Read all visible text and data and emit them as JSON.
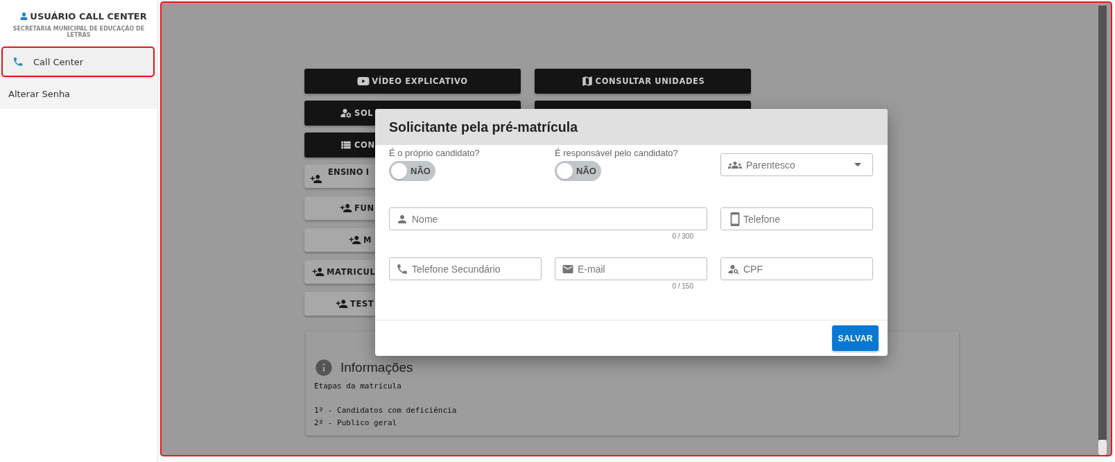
{
  "sidebar": {
    "user_title": "USUÁRIO CALL CENTER",
    "organization": "SECRETARIA MUNICIPAL DE EDUCAÇÃO DE LETRAS",
    "items": [
      {
        "label": "Call Center",
        "selected": true
      },
      {
        "label": "Alterar Senha",
        "selected": false
      }
    ]
  },
  "main": {
    "left_buttons": [
      {
        "label": "VÍDEO EXPLICATIVO",
        "kind": "dark"
      },
      {
        "label": "SOL",
        "kind": "dark"
      },
      {
        "label": "CON",
        "kind": "dark"
      },
      {
        "label": "ENSINO I",
        "kind": "light"
      },
      {
        "label": "FUN",
        "kind": "light"
      },
      {
        "label": "M",
        "kind": "light"
      },
      {
        "label": "MATRICUL",
        "kind": "light"
      },
      {
        "label": "TEST",
        "kind": "light"
      }
    ],
    "right_buttons": [
      {
        "label": "CONSULTAR UNIDADES",
        "kind": "dark"
      },
      {
        "kind": "dark"
      }
    ],
    "info": {
      "title": "Informações",
      "text": "Etapas da matrícula\n\n1ª - Candidatos com deficiência\n2ª - Publico geral"
    }
  },
  "dialog": {
    "title": "Solicitante pela pré-matrícula",
    "toggles": [
      {
        "label": "É o próprio candidato?",
        "value_text": "NÃO",
        "checked": false
      },
      {
        "label": "É responsável pelo candidato?",
        "value_text": "NÃO",
        "checked": false
      }
    ],
    "select": {
      "placeholder": "Parentesco"
    },
    "fields": [
      {
        "placeholder": "Nome",
        "counter": "0 / 300",
        "kind": "wide"
      },
      {
        "placeholder": "Telefone",
        "kind": "normal"
      },
      {
        "placeholder": "Telefone Secundário",
        "kind": "normal"
      },
      {
        "placeholder": "E-mail",
        "counter": "0 / 150",
        "kind": "normal"
      },
      {
        "placeholder": "CPF",
        "kind": "normal"
      }
    ],
    "save_button": "SALVAR"
  }
}
